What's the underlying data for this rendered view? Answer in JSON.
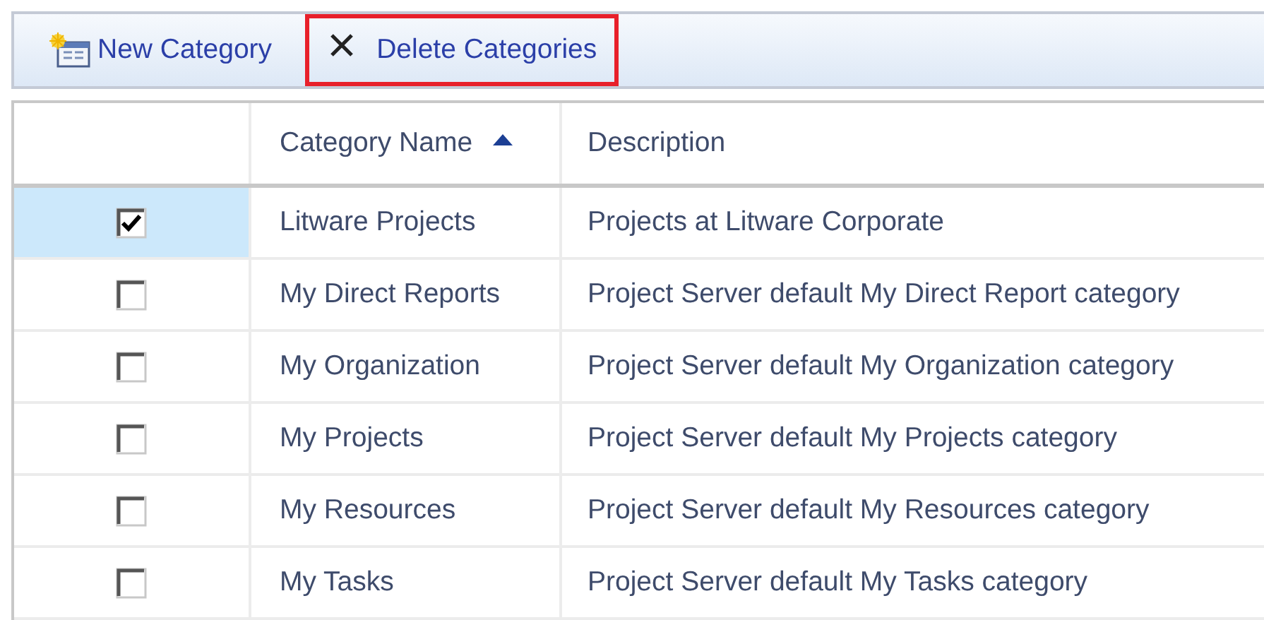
{
  "toolbar": {
    "buttons": [
      {
        "kind": "new",
        "label": "New Category",
        "highlighted": false
      },
      {
        "kind": "delete",
        "label": "Delete Categories",
        "highlighted": true
      }
    ]
  },
  "table": {
    "columns": [
      {
        "label": "Category Name",
        "sorted": true
      },
      {
        "label": "Description",
        "sorted": false
      }
    ],
    "rows": [
      {
        "checked": true,
        "selected": true,
        "name": "Litware Projects",
        "description": "Projects at Litware Corporate"
      },
      {
        "checked": false,
        "selected": false,
        "name": "My Direct Reports",
        "description": "Project Server default My Direct Report category"
      },
      {
        "checked": false,
        "selected": false,
        "name": "My Organization",
        "description": "Project Server default My Organization category"
      },
      {
        "checked": false,
        "selected": false,
        "name": "My Projects",
        "description": "Project Server default My Projects category"
      },
      {
        "checked": false,
        "selected": false,
        "name": "My Resources",
        "description": "Project Server default My Resources category"
      },
      {
        "checked": false,
        "selected": false,
        "name": "My Tasks",
        "description": "Project Server default My Tasks category"
      }
    ]
  }
}
